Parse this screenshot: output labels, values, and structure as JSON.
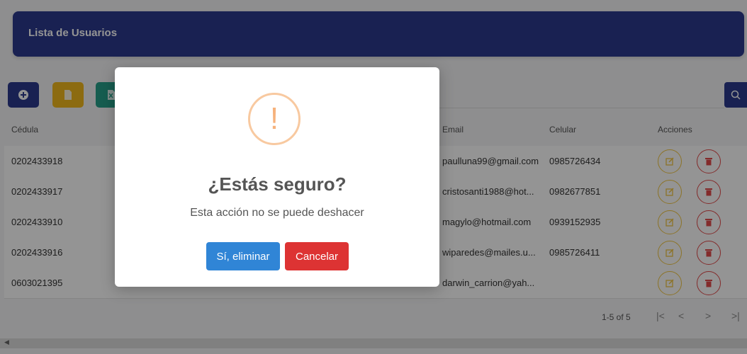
{
  "header": {
    "title": "Lista de Usuarios"
  },
  "toolbar": {
    "add_icon": "plus-circle-icon",
    "pdf_icon": "file-pdf-icon",
    "excel_icon": "file-excel-icon",
    "search_icon": "search-icon"
  },
  "table": {
    "columns": [
      "Cédula",
      "Email",
      "Celular",
      "Acciones"
    ],
    "rows": [
      {
        "cedula": "0202433918",
        "email": "paulluna99@gmail.com",
        "celular": "0985726434"
      },
      {
        "cedula": "0202433917",
        "email": "cristosanti1988@hot...",
        "celular": "0982677851"
      },
      {
        "cedula": "0202433910",
        "email": "magylo@hotmail.com",
        "celular": "0939152935"
      },
      {
        "cedula": "0202433916",
        "email": "wiparedes@mailes.u...",
        "celular": "0985726411"
      },
      {
        "cedula": "0603021395",
        "email": "darwin_carrion@yah...",
        "celular": ""
      }
    ]
  },
  "pagination": {
    "range": "1-5 of 5"
  },
  "modal": {
    "icon": "!",
    "title": "¿Estás seguro?",
    "text": "Esta acción no se puede deshacer",
    "confirm_label": "Sí, eliminar",
    "cancel_label": "Cancelar"
  },
  "colors": {
    "primary": "#2c3a8e",
    "warning": "#f2b81d",
    "success": "#27a18b",
    "confirm": "#3085d6",
    "cancel": "#dd3333"
  }
}
